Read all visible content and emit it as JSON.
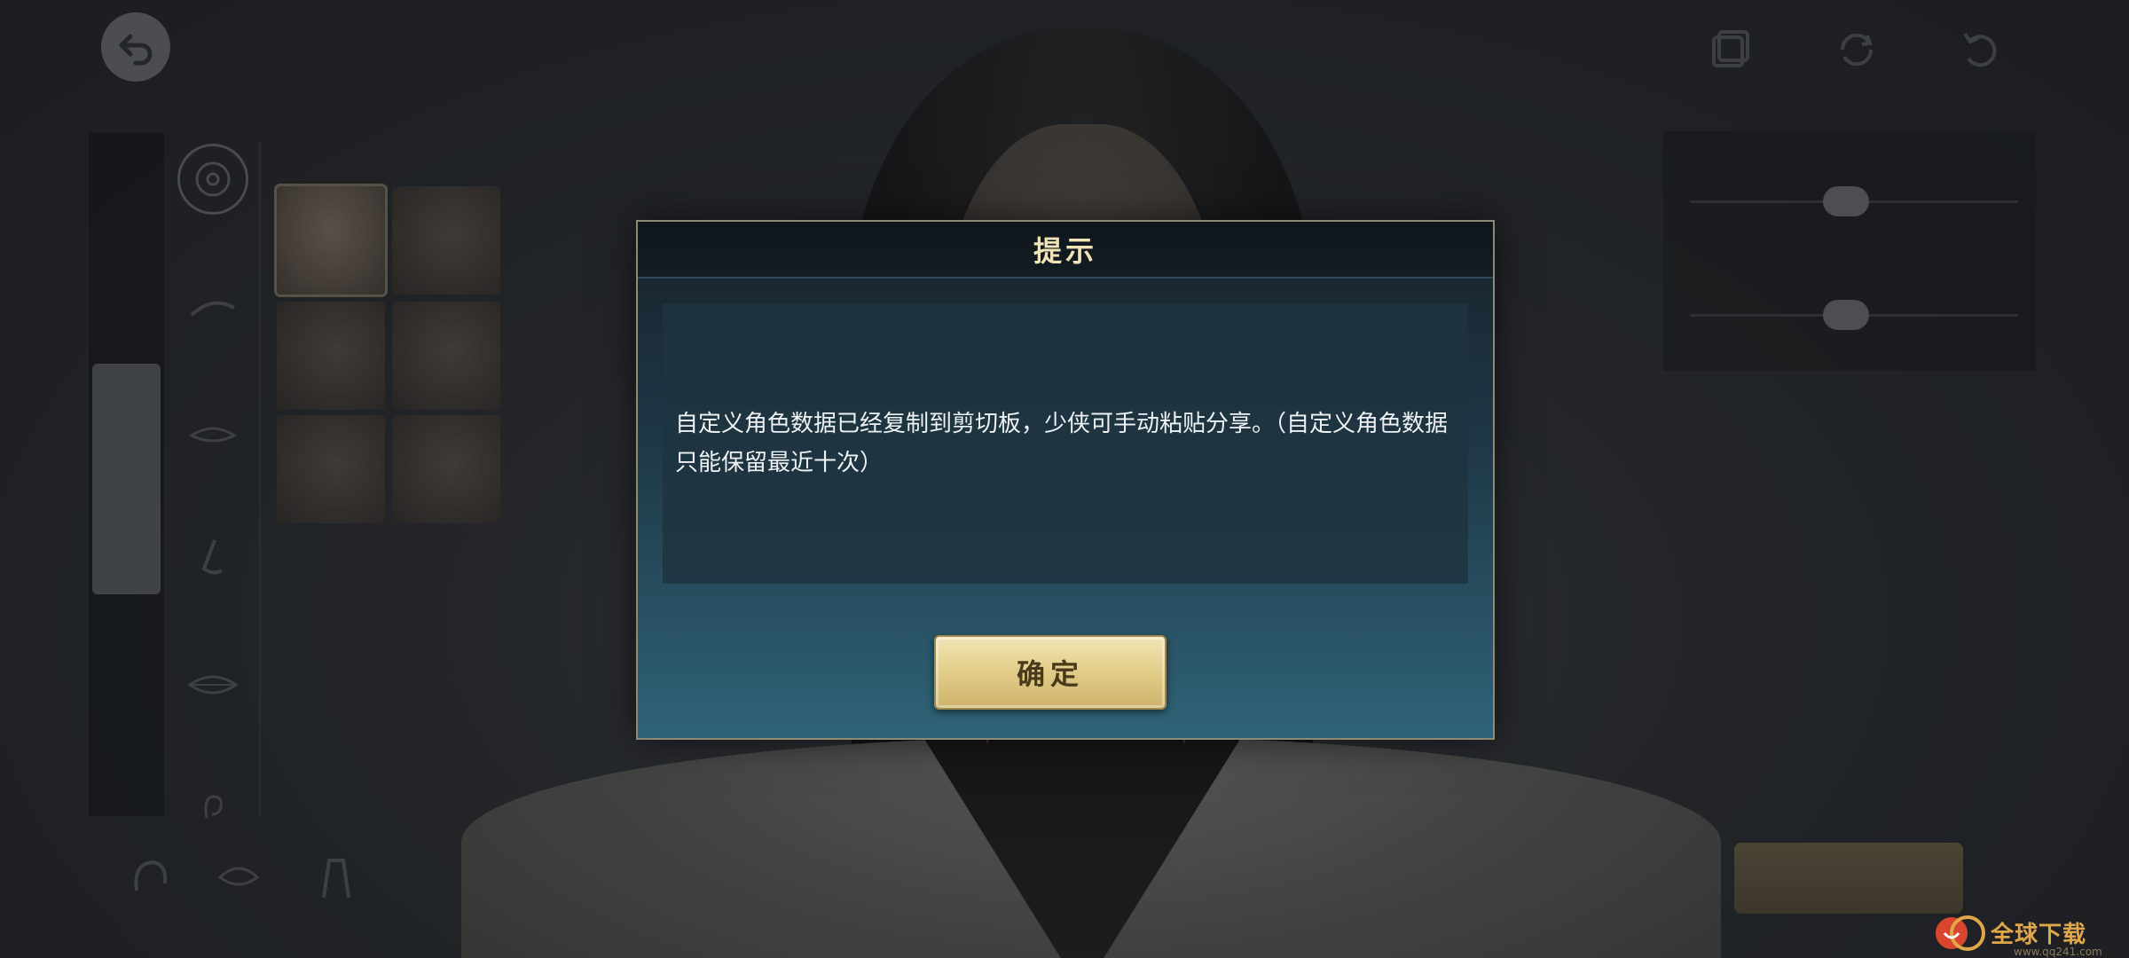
{
  "dialog": {
    "title": "提示",
    "message": "自定义角色数据已经复制到剪切板，少侠可手动粘贴分享。（自定义角色数据只能保留最近十次）",
    "confirm_label": "确定"
  },
  "background": {
    "note_visible_only_dimmed": "",
    "icons": {
      "back": "back-arrow-icon",
      "data": "data-layers-icon",
      "reset": "reset-cycle-icon",
      "undo": "undo-icon"
    }
  },
  "watermark": {
    "text": "全球下载",
    "url": "www.qq241.com"
  },
  "colors": {
    "dialog_title": "#f1e3b8",
    "button_gold": "#e3cf8c",
    "dialog_bg_top": "#17222b",
    "dialog_bg_bottom": "#2f6377"
  }
}
